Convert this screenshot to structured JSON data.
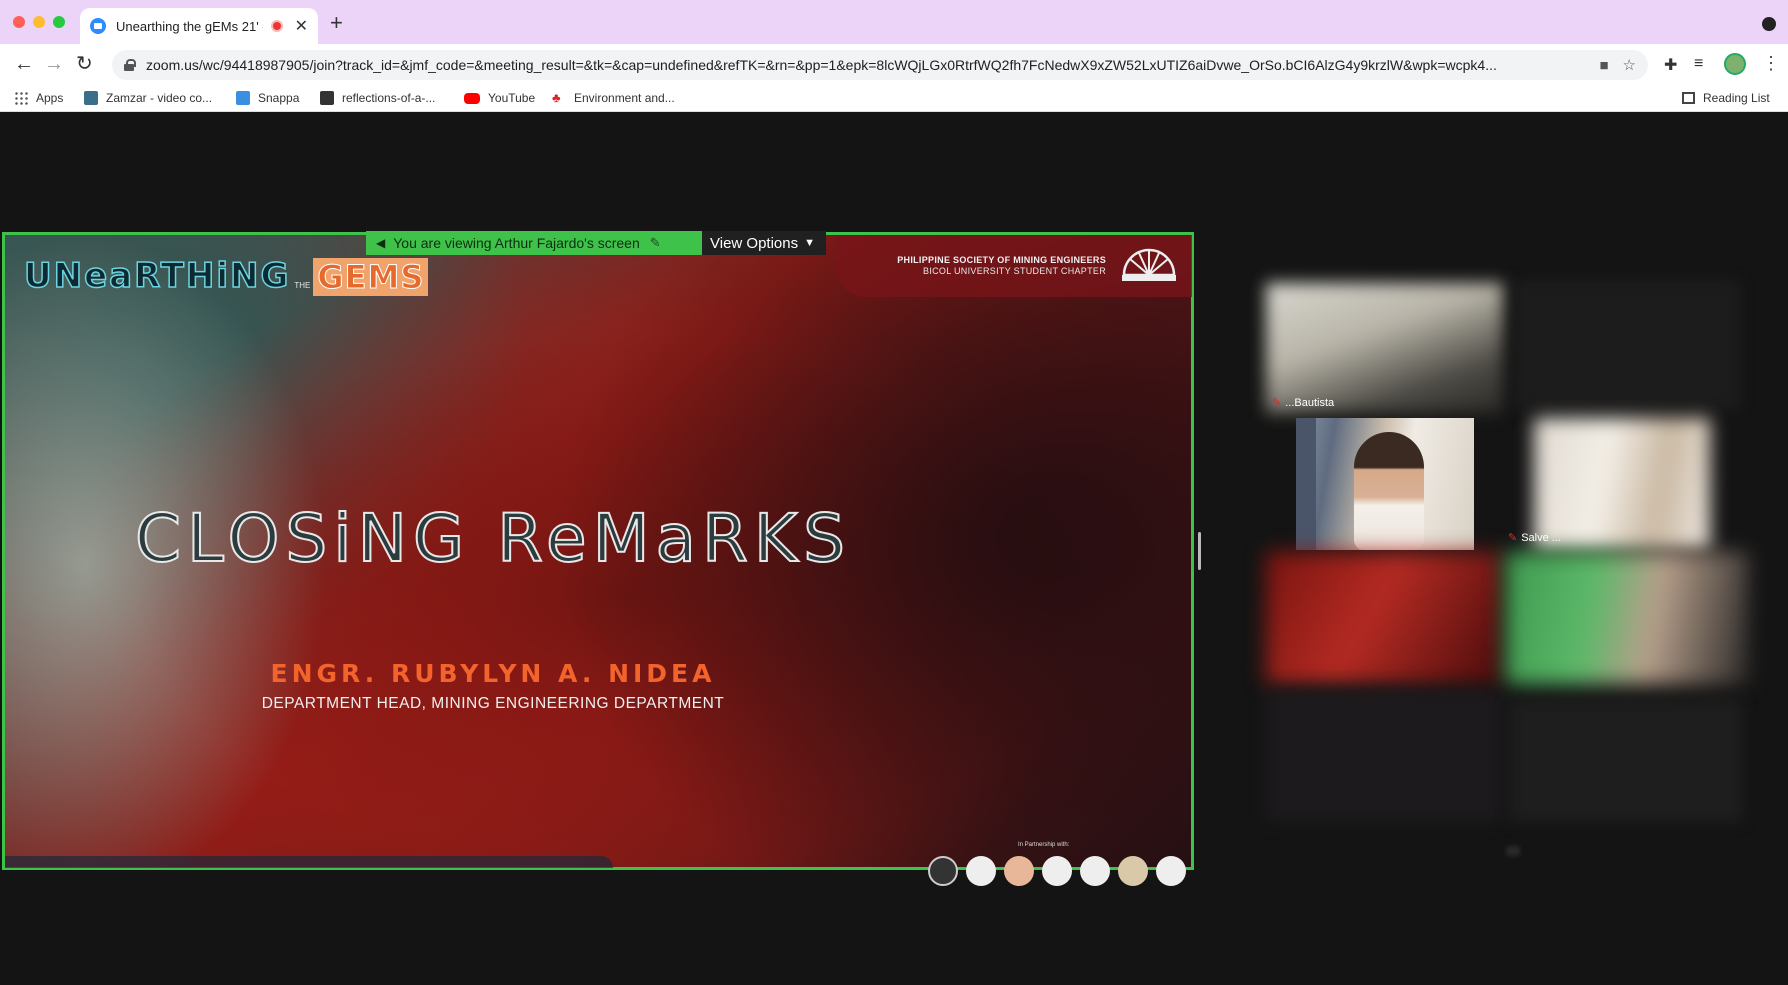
{
  "browser": {
    "tab_title": "Unearthing the gEMs 21' - ",
    "tab_close": "✕",
    "new_tab": "+",
    "url": "zoom.us/wc/94418987905/join?track_id=&jmf_code=&meeting_result=&tk=&cap=undefined&refTK=&rn=&pp=1&epk=8lcWQjLGx0RtrfWQ2fh7FcNedwX9xZW52LxUTIZ6aiDvwe_OrSo.bCI6AlzG4y9krzlW&wpk=wcpk4...",
    "bookmarks": [
      {
        "label": "Apps",
        "icon": "apps-grid-icon"
      },
      {
        "label": "Zamzar - video co...",
        "icon": "zamzar-icon"
      },
      {
        "label": "Snappa",
        "icon": "snappa-icon"
      },
      {
        "label": "reflections-of-a-...",
        "icon": "page-icon"
      },
      {
        "label": "YouTube",
        "icon": "youtube-icon"
      },
      {
        "label": "Environment and...",
        "icon": "maple-leaf-icon"
      }
    ],
    "reading_list": "Reading List"
  },
  "zoom": {
    "viewing_banner": "You are viewing Arthur Fajardo's screen",
    "view_options": "View Options",
    "gallery_names": [
      "...Bautista",
      "Salve ..."
    ]
  },
  "slide": {
    "logo_main": "UNeaRTHiNG",
    "logo_the": "THE",
    "logo_gems": "GEMS",
    "org_line1": "PHILIPPINE SOCIETY OF MINING ENGINEERS",
    "org_line2": "BICOL UNIVERSITY STUDENT CHAPTER",
    "title": "CLOSiNG ReMaRKS",
    "speaker_name": "ENGR. RUBYLYN A. NIDEA",
    "speaker_role": "DEPARTMENT HEAD, MINING ENGINEERING DEPARTMENT",
    "partnership": "In Partnership with:"
  },
  "colors": {
    "share_border": "#3ec24a",
    "name_accent": "#f2642b",
    "tab_strip": "#ecd4f8"
  }
}
